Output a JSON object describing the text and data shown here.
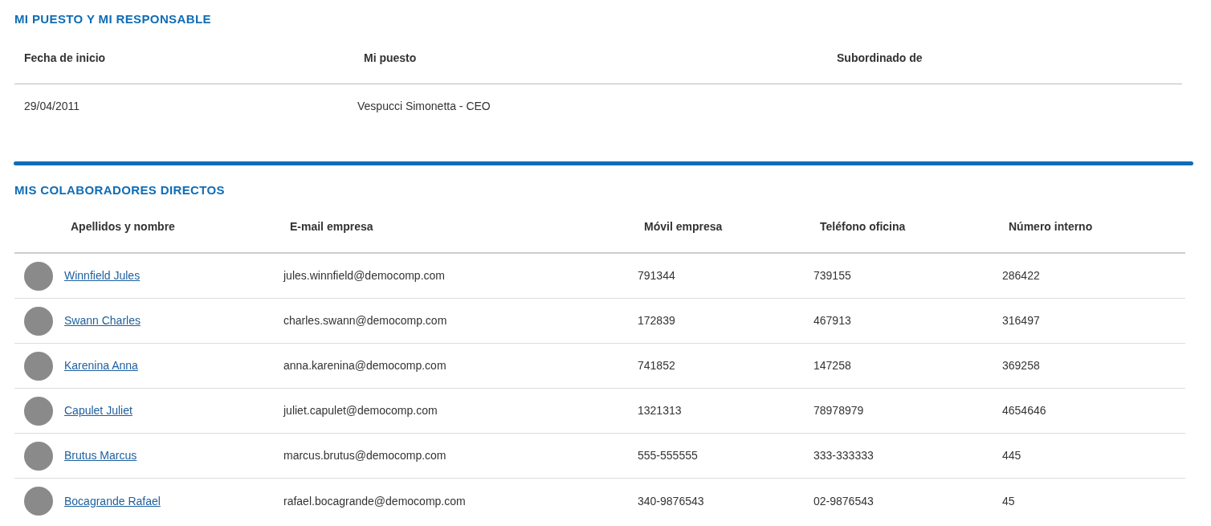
{
  "position_section": {
    "title": "MI PUESTO Y MI RESPONSABLE",
    "columns": [
      "Fecha de inicio",
      "Mi puesto",
      "Subordinado de"
    ],
    "row": [
      "29/04/2011",
      "Vespucci Simonetta - CEO"
    ]
  },
  "collaborators_section": {
    "title": "MIS COLABORADORES DIRECTOS",
    "columns": [
      "Apellidos y nombre",
      "E-mail empresa",
      "Móvil empresa",
      "Teléfono oficina",
      "Número interno"
    ],
    "rows": [
      {
        "name": "Winnfield Jules",
        "email": "jules.winnfield@democomp.com",
        "mobile": "791344",
        "office_phone": "739155",
        "internal_number": "286422"
      },
      {
        "name": "Swann Charles",
        "email": "charles.swann@democomp.com",
        "mobile": "172839",
        "office_phone": "467913",
        "internal_number": "316497"
      },
      {
        "name": "Karenina Anna",
        "email": "anna.karenina@democomp.com",
        "mobile": "741852",
        "office_phone": "147258",
        "internal_number": "369258"
      },
      {
        "name": "Capulet Juliet",
        "email": "juliet.capulet@democomp.com",
        "mobile": "1321313",
        "office_phone": "78978979",
        "internal_number": "4654646"
      },
      {
        "name": "Brutus Marcus",
        "email": "marcus.brutus@democomp.com",
        "mobile": "555-555555",
        "office_phone": "333-333333",
        "internal_number": "445"
      },
      {
        "name": "Bocagrande Rafael",
        "email": "rafael.bocagrande@democomp.com",
        "mobile": "340-9876543",
        "office_phone": "02-9876543",
        "internal_number": "45"
      }
    ]
  }
}
